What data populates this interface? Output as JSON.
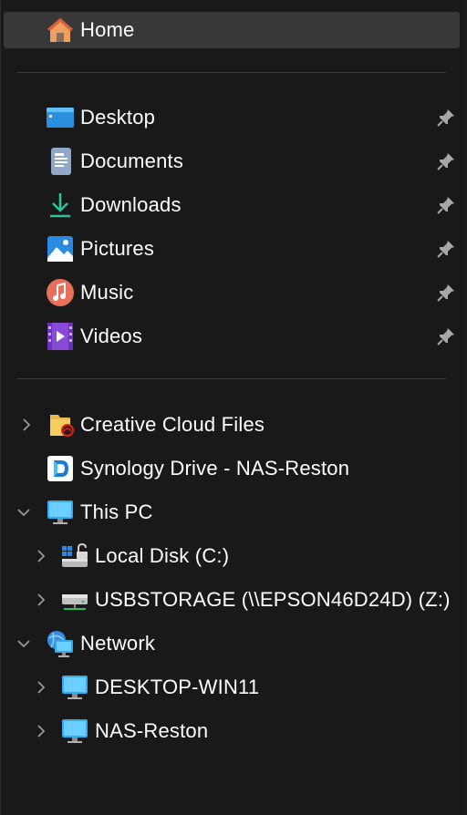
{
  "nav": {
    "home": {
      "label": "Home",
      "icon": "home-icon"
    },
    "quick_access": [
      {
        "label": "Desktop",
        "icon": "desktop-folder-icon",
        "pinned": true
      },
      {
        "label": "Documents",
        "icon": "documents-icon",
        "pinned": true
      },
      {
        "label": "Downloads",
        "icon": "downloads-icon",
        "pinned": true
      },
      {
        "label": "Pictures",
        "icon": "pictures-icon",
        "pinned": true
      },
      {
        "label": "Music",
        "icon": "music-icon",
        "pinned": true
      },
      {
        "label": "Videos",
        "icon": "videos-icon",
        "pinned": true
      }
    ],
    "tree": [
      {
        "label": "Creative Cloud Files",
        "icon": "creative-cloud-folder-icon",
        "expander": "collapsed"
      },
      {
        "label": "Synology Drive - NAS-Reston",
        "icon": "synology-drive-icon",
        "expander": "none"
      },
      {
        "label": "This PC",
        "icon": "this-pc-icon",
        "expander": "expanded"
      },
      {
        "label": "Local Disk (C:)",
        "icon": "local-disk-icon",
        "expander": "collapsed"
      },
      {
        "label": "USBSTORAGE (\\\\EPSON46D24D) (Z:)",
        "icon": "network-drive-icon",
        "expander": "collapsed"
      },
      {
        "label": "Network",
        "icon": "network-icon",
        "expander": "expanded"
      },
      {
        "label": "DESKTOP-WIN11",
        "icon": "computer-icon",
        "expander": "collapsed"
      },
      {
        "label": "NAS-Reston",
        "icon": "computer-icon",
        "expander": "collapsed"
      }
    ]
  },
  "colors": {
    "background": "#191919",
    "selected": "#383838",
    "text": "#ffffff",
    "chevron": "#9a9a9a"
  }
}
